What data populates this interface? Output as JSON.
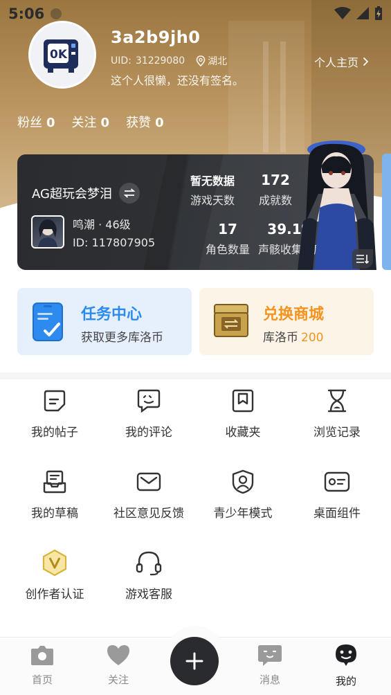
{
  "status_bar": {
    "time": "5:06"
  },
  "profile": {
    "username": "3a2b9jh0",
    "uid_label": "UID:",
    "uid": "31229080",
    "location": "湖北",
    "bio": "这个人很懒，还没有签名。",
    "profile_link": "个人主页"
  },
  "stats": [
    {
      "label": "粉丝",
      "value": "0"
    },
    {
      "label": "关注",
      "value": "0"
    },
    {
      "label": "获赞",
      "value": "0"
    }
  ],
  "game_card": {
    "server_name": "AG超玩会梦泪",
    "role": "鸣潮 · 46级",
    "role_id": "ID: 117807905",
    "stats": [
      {
        "value": "暂无数据",
        "label": "游戏天数"
      },
      {
        "value": "172",
        "label": "成就数"
      },
      {
        "value": "17",
        "label": "角色数量"
      },
      {
        "value": "39.1%",
        "label": "声骸收集进度"
      }
    ]
  },
  "promos": {
    "task": {
      "title": "任务中心",
      "subtitle": "获取更多库洛币"
    },
    "shop": {
      "title": "兑换商城",
      "subtitle": "库洛币",
      "amount": "200"
    }
  },
  "menu": [
    {
      "label": "我的帖子",
      "icon": "post-icon"
    },
    {
      "label": "我的评论",
      "icon": "comment-icon"
    },
    {
      "label": "收藏夹",
      "icon": "bookmark-icon"
    },
    {
      "label": "浏览记录",
      "icon": "hourglass-icon"
    },
    {
      "label": "我的草稿",
      "icon": "drafts-icon"
    },
    {
      "label": "社区意见反馈",
      "icon": "mail-icon"
    },
    {
      "label": "青少年模式",
      "icon": "shield-person-icon"
    },
    {
      "label": "桌面组件",
      "icon": "widget-card-icon"
    },
    {
      "label": "创作者认证",
      "icon": "creator-badge-icon"
    },
    {
      "label": "游戏客服",
      "icon": "headset-icon"
    }
  ],
  "tabbar": [
    {
      "label": "首页",
      "icon": "home-camera-icon",
      "active": false
    },
    {
      "label": "关注",
      "icon": "heart-icon",
      "active": false
    },
    {
      "label": "消息",
      "icon": "message-icon",
      "active": false
    },
    {
      "label": "我的",
      "icon": "profile-face-icon",
      "active": true
    }
  ],
  "colors": {
    "accent_blue": "#2d8bf0",
    "accent_orange": "#f5931f",
    "card_dark": "#2e3034"
  }
}
